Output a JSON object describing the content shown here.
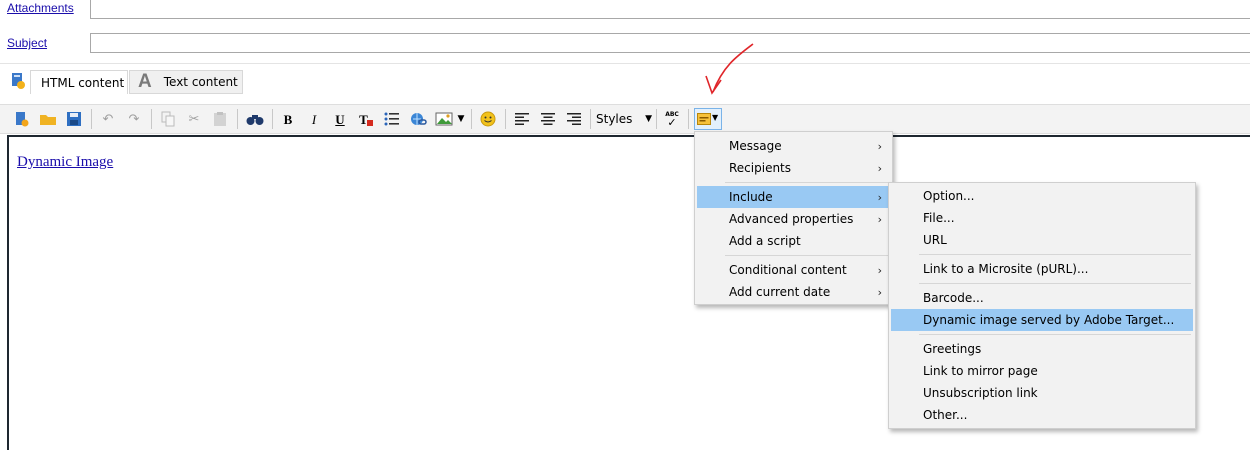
{
  "fields": {
    "attachments_label": "Attachments",
    "subject_label": "Subject",
    "subject_value": ""
  },
  "tabs": [
    {
      "label": "HTML content",
      "active": true,
      "icon": "html-content-icon"
    },
    {
      "label": "Text content",
      "active": false,
      "icon": "text-content-icon"
    }
  ],
  "toolbar": {
    "styles_label": "Styles",
    "spell_label": "ABC",
    "bold": "B",
    "italic": "I",
    "underline": "U",
    "clear_format": "T"
  },
  "editor": {
    "image_alt": "Dynamic Image"
  },
  "menu": {
    "items": [
      {
        "label": "Message",
        "submenu": true
      },
      {
        "label": "Recipients",
        "submenu": true
      },
      {
        "label": "Include",
        "submenu": true,
        "highlighted": true
      },
      {
        "label": "Advanced properties",
        "submenu": true
      },
      {
        "label": "Add a script",
        "submenu": false
      },
      {
        "label": "Conditional content",
        "submenu": true
      },
      {
        "label": "Add current date",
        "submenu": true
      }
    ]
  },
  "submenu": {
    "items": [
      {
        "label": "Option..."
      },
      {
        "label": "File..."
      },
      {
        "label": "URL"
      },
      {
        "label": "Link to a Microsite (pURL)..."
      },
      {
        "label": "Barcode..."
      },
      {
        "label": "Dynamic image served by Adobe Target...",
        "highlighted": true
      },
      {
        "label": "Greetings"
      },
      {
        "label": "Link to mirror page"
      },
      {
        "label": "Unsubscription link"
      },
      {
        "label": "Other..."
      }
    ]
  },
  "colors": {
    "highlight": "#99c9f3",
    "annotation_arrow": "#e0262a",
    "link": "#1a0dab"
  }
}
